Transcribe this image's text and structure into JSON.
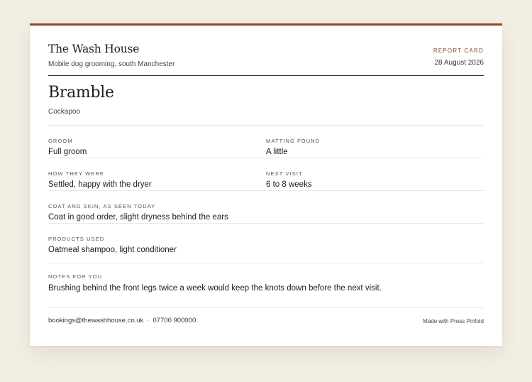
{
  "business": {
    "name": "The Wash House",
    "tagline": "Mobile dog grooming, south Manchester"
  },
  "document": {
    "label": "REPORT CARD",
    "date": "28 August 2026"
  },
  "pet": {
    "name": "Bramble",
    "breed": "Cockapoo"
  },
  "fields": {
    "groom": {
      "label": "GROOM",
      "value": "Full groom"
    },
    "matting": {
      "label": "MATTING FOUND",
      "value": "A little"
    },
    "behaviour": {
      "label": "HOW THEY WERE",
      "value": "Settled, happy with the dryer"
    },
    "next_visit": {
      "label": "NEXT VISIT",
      "value": "6 to 8 weeks"
    },
    "coat": {
      "label": "COAT AND SKIN, AS SEEN TODAY",
      "value": "Coat in good order, slight dryness behind the ears"
    },
    "products": {
      "label": "PRODUCTS USED",
      "value": "Oatmeal shampoo, light conditioner"
    },
    "notes": {
      "label": "NOTES FOR YOU",
      "value": "Brushing behind the front legs twice a week would keep the knots down before the next visit."
    }
  },
  "footer": {
    "email": "bookings@thewashhouse.co.uk",
    "separator": "·",
    "phone": "07700 900000",
    "made_with": "Made with Press Pinfold"
  },
  "colors": {
    "accent": "#8a4b2c",
    "background": "#f3efe4",
    "card": "#ffffff"
  }
}
